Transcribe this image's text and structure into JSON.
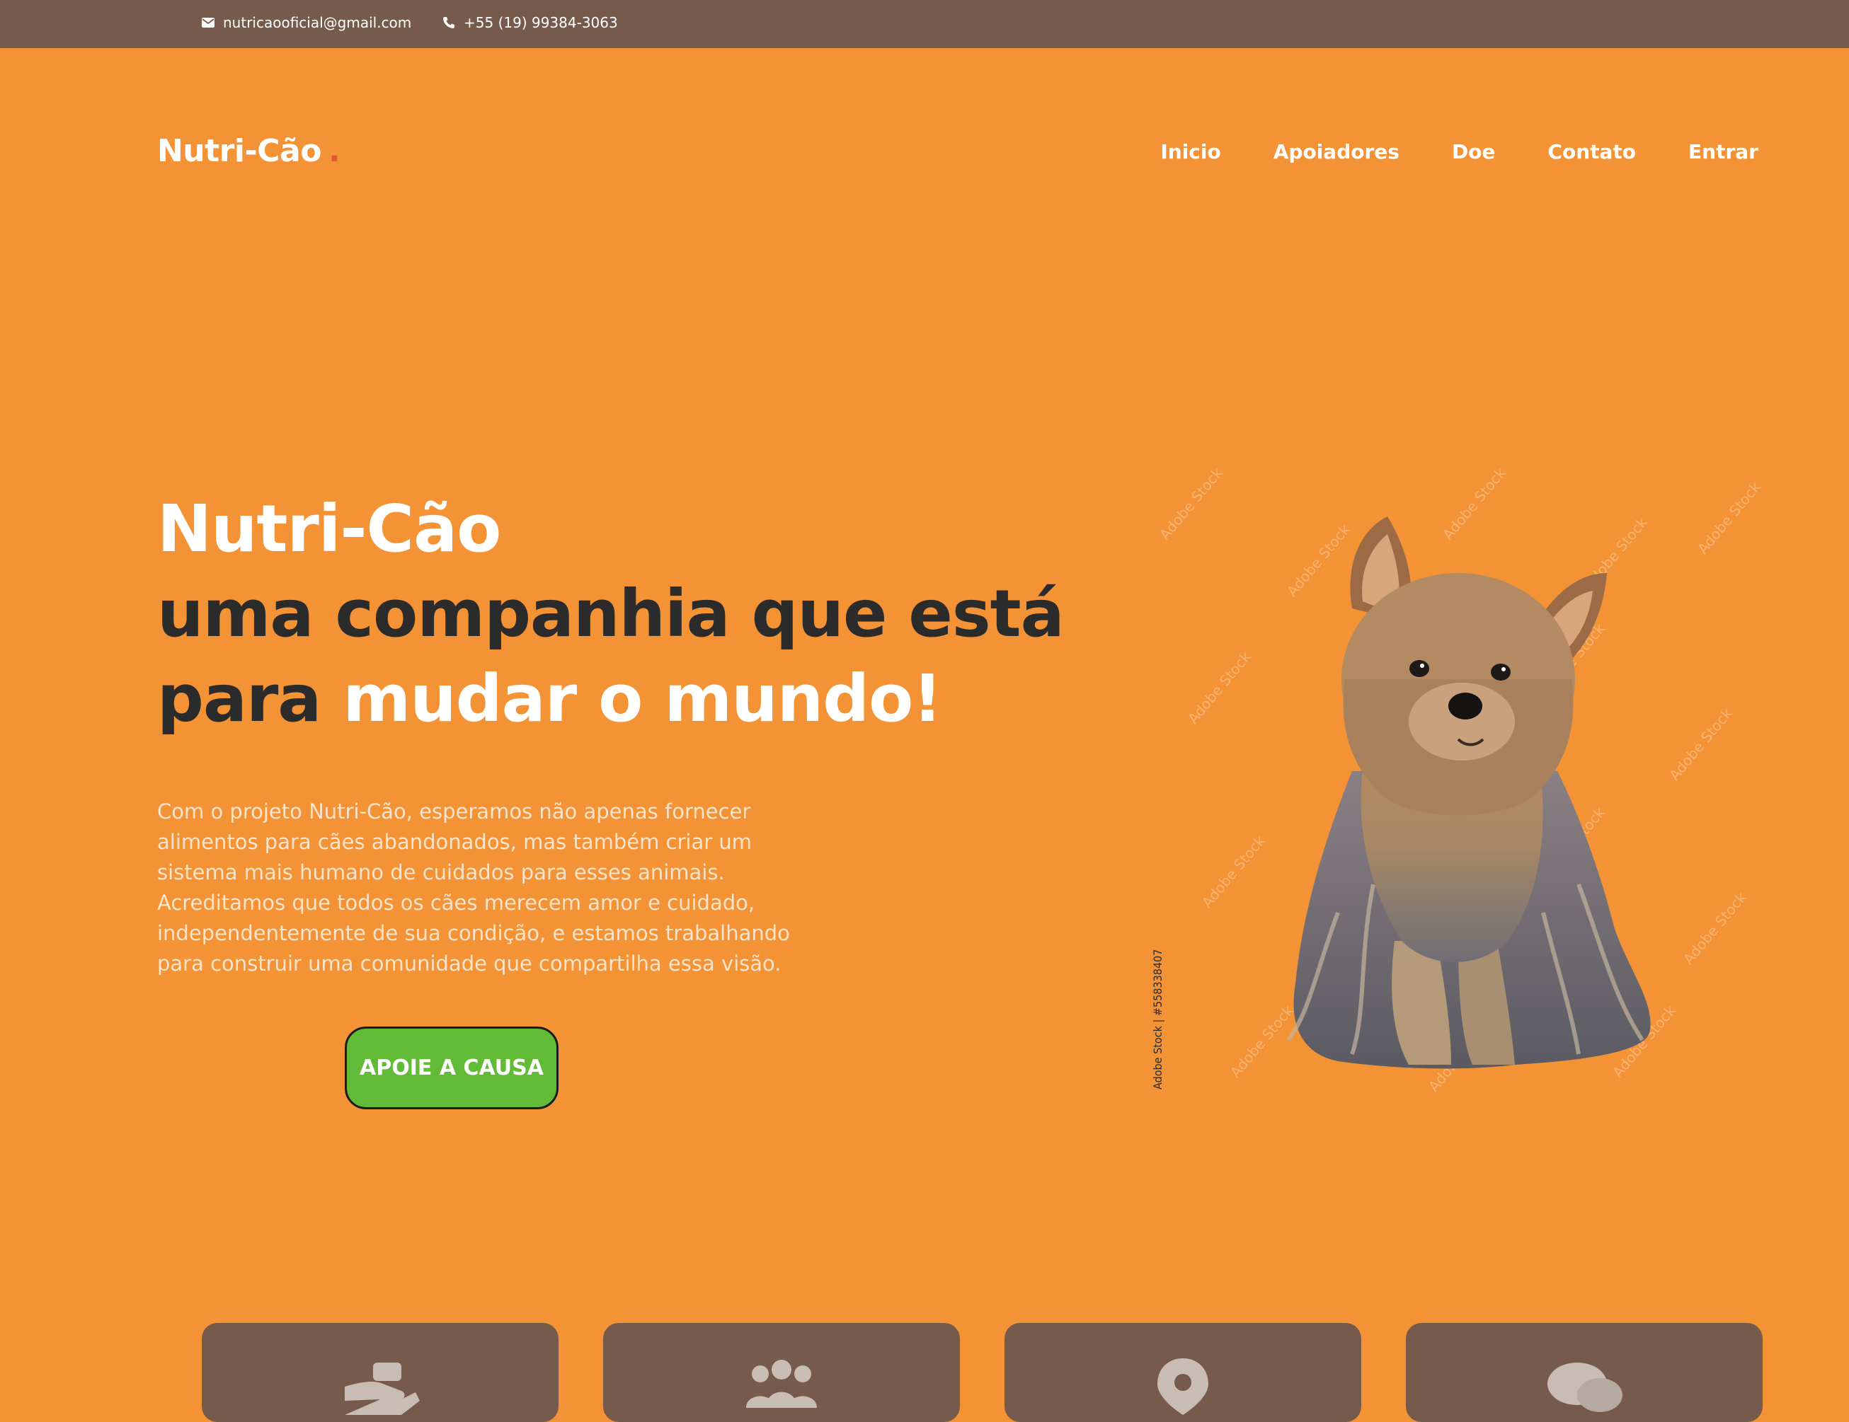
{
  "topbar": {
    "email": "nutricaooficial@gmail.com",
    "phone": "+55 (19) 99384-3063"
  },
  "header": {
    "logo": "Nutri-Cão",
    "logo_dot": ".",
    "nav": [
      "Inicio",
      "Apoiadores",
      "Doe",
      "Contato",
      "Entrar"
    ]
  },
  "hero": {
    "title_line1": "Nutri-Cão",
    "title_line2": "uma companhia que está",
    "title_line3_dark": "para",
    "title_line3_light": "mudar o mundo!",
    "description": "Com o projeto Nutri-Cão, esperamos não apenas fornecer alimentos para cães abandonados, mas também criar um sistema mais humano de cuidados para esses animais. Acreditamos que todos os cães merecem amor e cuidado, independentemente de sua condição, e estamos trabalhando para construir uma comunidade que compartilha essa visão.",
    "cta_label": "APOIE A CAUSA",
    "image_credit": "Adobe Stock | #558338407",
    "watermark_text": "Adobe Stock"
  },
  "cards": {
    "icons": [
      "donate-hand-icon",
      "group-people-icon",
      "location-pin-icon",
      "chat-bubbles-icon"
    ]
  },
  "colors": {
    "background": "#f39335",
    "topbar": "#765a4b",
    "cta": "#61bb37",
    "card": "#765a4b",
    "dark_text": "#2b2b2b",
    "logo_dot": "#e8543a"
  }
}
